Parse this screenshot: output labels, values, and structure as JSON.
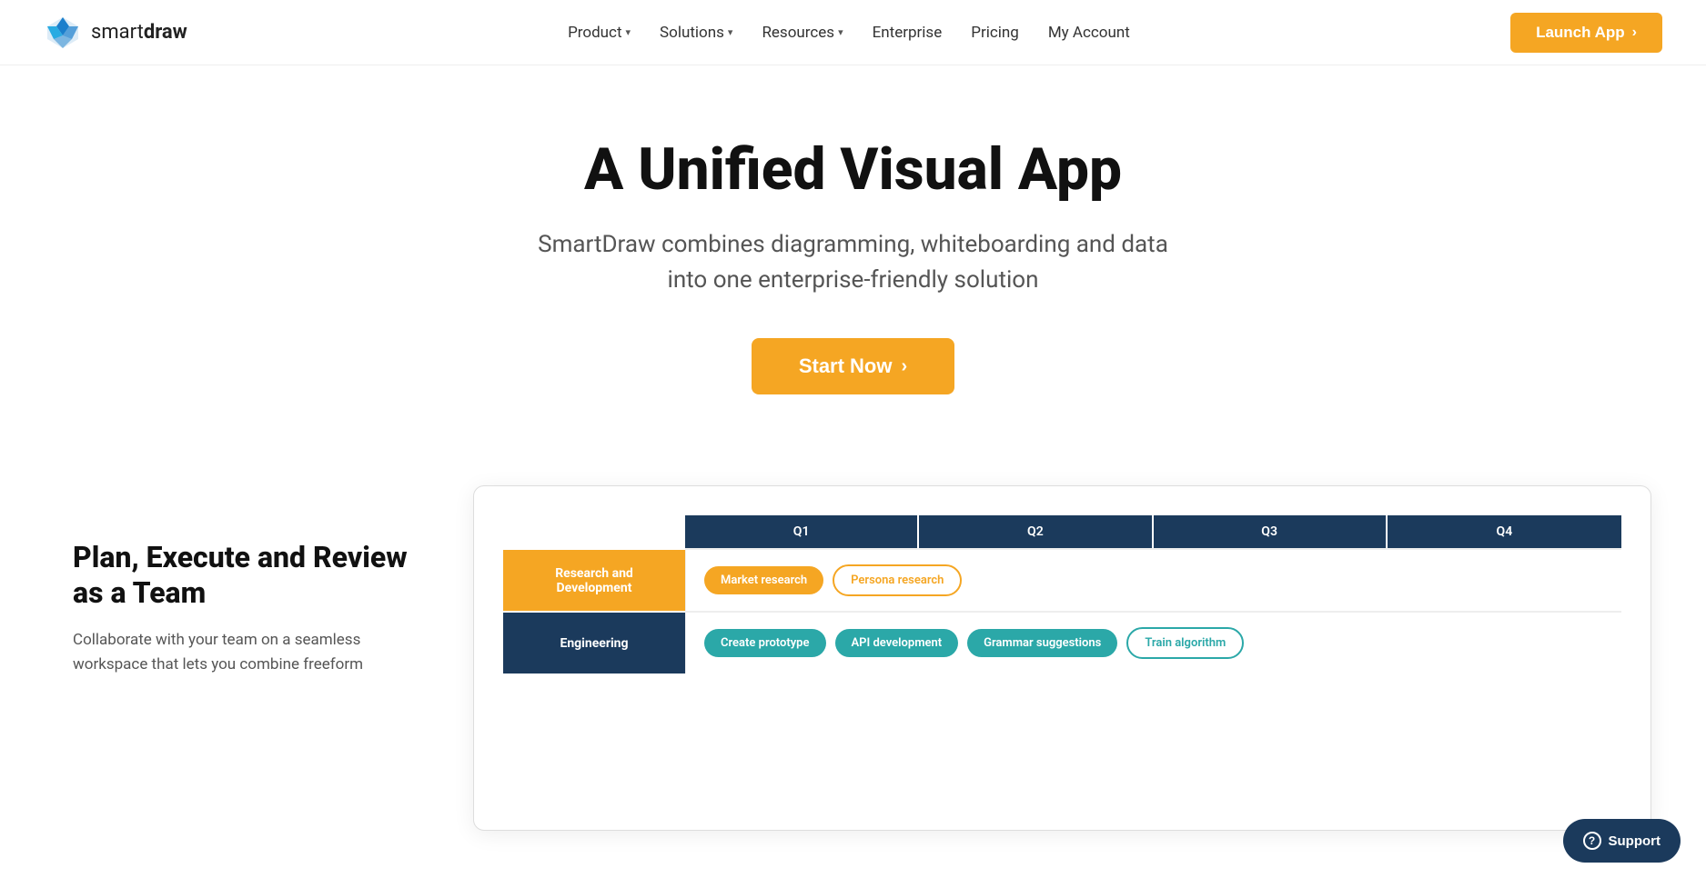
{
  "logo": {
    "text_plain": "smart",
    "text_bold": "draw",
    "icon_alt": "SmartDraw logo"
  },
  "nav": {
    "links": [
      {
        "label": "Product",
        "has_dropdown": true
      },
      {
        "label": "Solutions",
        "has_dropdown": true
      },
      {
        "label": "Resources",
        "has_dropdown": true
      },
      {
        "label": "Enterprise",
        "has_dropdown": false
      },
      {
        "label": "Pricing",
        "has_dropdown": false
      },
      {
        "label": "My Account",
        "has_dropdown": false
      }
    ],
    "cta_label": "Launch App",
    "cta_arrow": "›"
  },
  "hero": {
    "heading": "A Unified Visual App",
    "subheading": "SmartDraw combines diagramming, whiteboarding and data into one enterprise-friendly solution",
    "cta_label": "Start Now",
    "cta_arrow": "›"
  },
  "left_panel": {
    "heading": "Plan, Execute and Review as a Team",
    "body": "Collaborate with your team on a seamless workspace that lets you combine freeform"
  },
  "diagram": {
    "quarters": [
      "Q1",
      "Q2",
      "Q3",
      "Q4"
    ],
    "rows": [
      {
        "label": "Research and Development",
        "style": "orange",
        "tags": [
          {
            "text": "Market research",
            "style": "orange"
          },
          {
            "text": "Persona research",
            "style": "orange-outline"
          }
        ]
      },
      {
        "label": "Engineering",
        "style": "dark",
        "tags": [
          {
            "text": "Create prototype",
            "style": "teal"
          },
          {
            "text": "API development",
            "style": "teal"
          },
          {
            "text": "Grammar suggestions",
            "style": "teal"
          },
          {
            "text": "Train algorithm",
            "style": "teal-outline"
          }
        ]
      }
    ]
  },
  "support": {
    "label": "Support",
    "icon": "?"
  },
  "colors": {
    "orange": "#F5A623",
    "navy": "#1B3A5C",
    "teal": "#2BA8A8"
  }
}
